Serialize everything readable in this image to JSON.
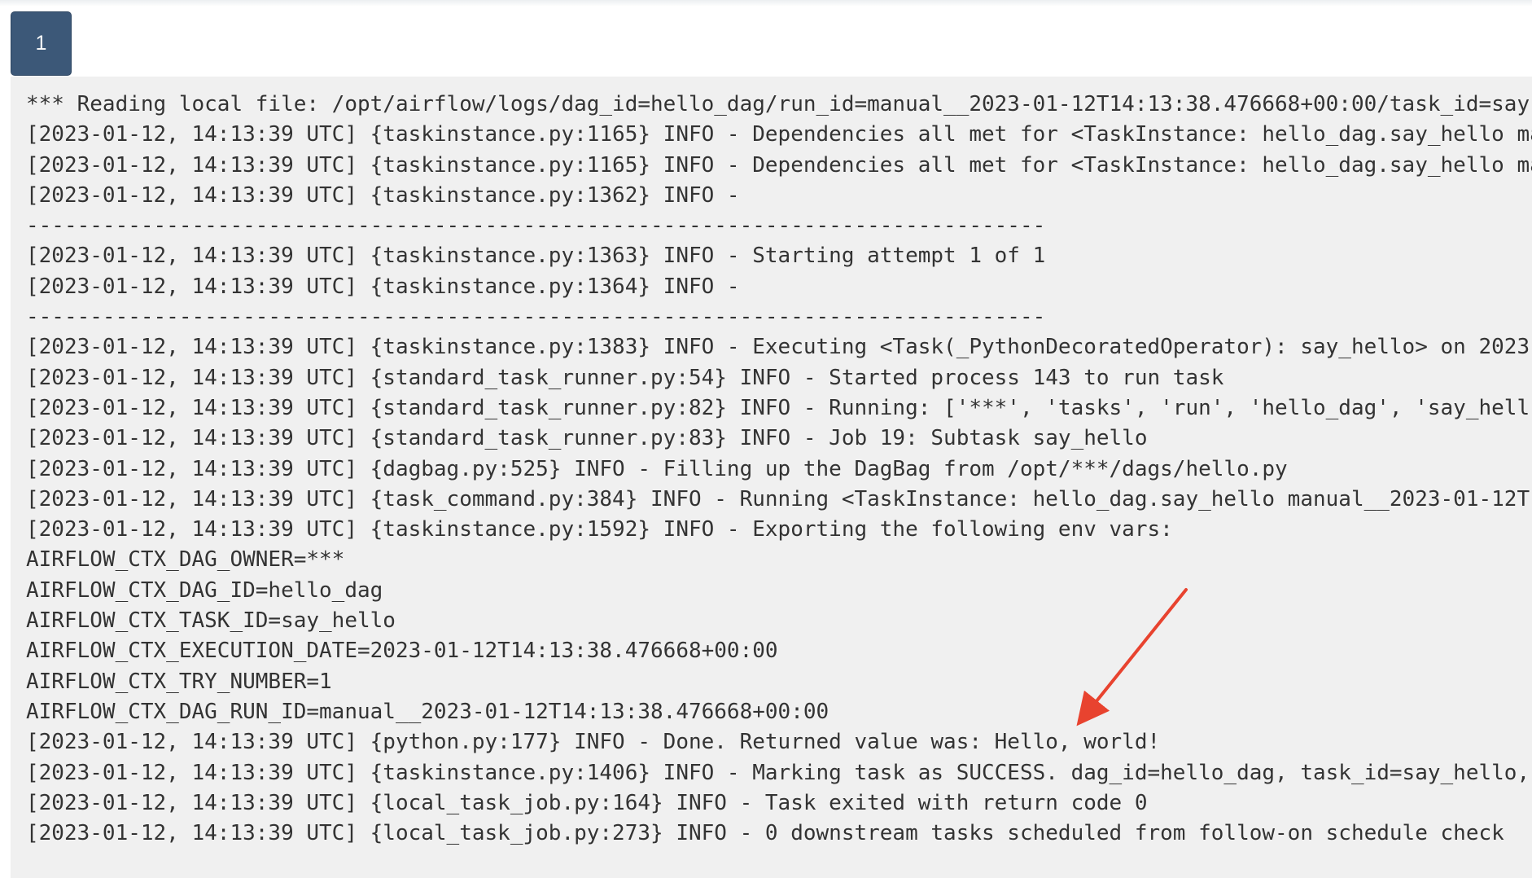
{
  "attempt_tabs": [
    {
      "label": "1"
    }
  ],
  "log": {
    "lines": [
      "*** Reading local file: /opt/airflow/logs/dag_id=hello_dag/run_id=manual__2023-01-12T14:13:38.476668+00:00/task_id=say",
      "[2023-01-12, 14:13:39 UTC] {taskinstance.py:1165} INFO - Dependencies all met for <TaskInstance: hello_dag.say_hello ma",
      "[2023-01-12, 14:13:39 UTC] {taskinstance.py:1165} INFO - Dependencies all met for <TaskInstance: hello_dag.say_hello ma",
      "[2023-01-12, 14:13:39 UTC] {taskinstance.py:1362} INFO -",
      "--------------------------------------------------------------------------------",
      "[2023-01-12, 14:13:39 UTC] {taskinstance.py:1363} INFO - Starting attempt 1 of 1",
      "[2023-01-12, 14:13:39 UTC] {taskinstance.py:1364} INFO -",
      "--------------------------------------------------------------------------------",
      "[2023-01-12, 14:13:39 UTC] {taskinstance.py:1383} INFO - Executing <Task(_PythonDecoratedOperator): say_hello> on 2023-",
      "[2023-01-12, 14:13:39 UTC] {standard_task_runner.py:54} INFO - Started process 143 to run task",
      "[2023-01-12, 14:13:39 UTC] {standard_task_runner.py:82} INFO - Running: ['***', 'tasks', 'run', 'hello_dag', 'say_hell",
      "[2023-01-12, 14:13:39 UTC] {standard_task_runner.py:83} INFO - Job 19: Subtask say_hello",
      "[2023-01-12, 14:13:39 UTC] {dagbag.py:525} INFO - Filling up the DagBag from /opt/***/dags/hello.py",
      "[2023-01-12, 14:13:39 UTC] {task_command.py:384} INFO - Running <TaskInstance: hello_dag.say_hello manual__2023-01-12T",
      "[2023-01-12, 14:13:39 UTC] {taskinstance.py:1592} INFO - Exporting the following env vars:",
      "AIRFLOW_CTX_DAG_OWNER=***",
      "AIRFLOW_CTX_DAG_ID=hello_dag",
      "AIRFLOW_CTX_TASK_ID=say_hello",
      "AIRFLOW_CTX_EXECUTION_DATE=2023-01-12T14:13:38.476668+00:00",
      "AIRFLOW_CTX_TRY_NUMBER=1",
      "AIRFLOW_CTX_DAG_RUN_ID=manual__2023-01-12T14:13:38.476668+00:00",
      "[2023-01-12, 14:13:39 UTC] {python.py:177} INFO - Done. Returned value was: Hello, world!",
      "[2023-01-12, 14:13:39 UTC] {taskinstance.py:1406} INFO - Marking task as SUCCESS. dag_id=hello_dag, task_id=say_hello,",
      "[2023-01-12, 14:13:39 UTC] {local_task_job.py:164} INFO - Task exited with return code 0",
      "[2023-01-12, 14:13:39 UTC] {local_task_job.py:273} INFO - 0 downstream tasks scheduled from follow-on schedule check"
    ]
  },
  "annotation": {
    "arrow_color": "#e8432f"
  }
}
